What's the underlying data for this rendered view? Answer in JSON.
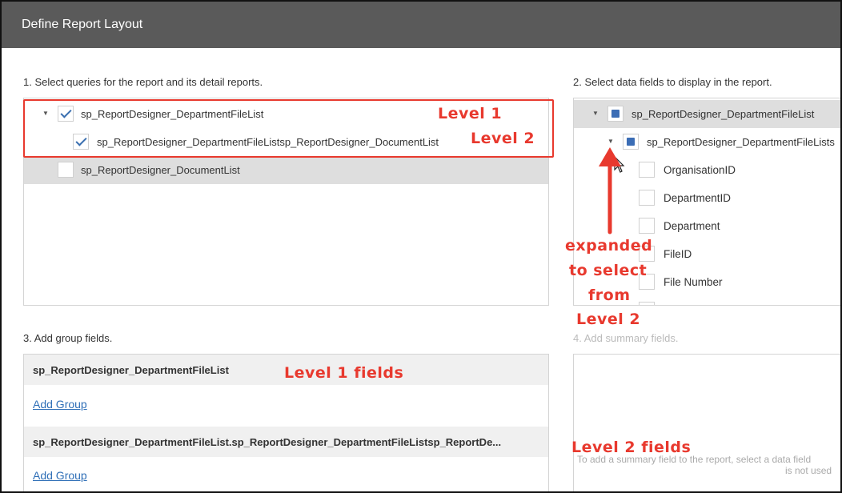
{
  "window": {
    "title": "Define Report Layout"
  },
  "sections": {
    "queries_label": "1. Select queries for the report and its detail reports.",
    "fields_label": "2. Select data fields to display in the report.",
    "group_label": "3. Add group fields.",
    "summary_label": "4. Add summary fields."
  },
  "queries": [
    {
      "label": "sp_ReportDesigner_DepartmentFileList",
      "checked": true,
      "expanded": true
    },
    {
      "label": "sp_ReportDesigner_DepartmentFileListsp_ReportDesigner_DocumentList",
      "checked": true
    },
    {
      "label": "sp_ReportDesigner_DocumentList",
      "checked": false,
      "selected": true
    }
  ],
  "fields_tree": {
    "root": "sp_ReportDesigner_DepartmentFileList",
    "child": "sp_ReportDesigner_DepartmentFileLists",
    "fields": [
      "OrganisationID",
      "DepartmentID",
      "Department",
      "FileID",
      "File Number"
    ]
  },
  "groups": [
    {
      "header": "sp_ReportDesigner_DepartmentFileList",
      "link": "Add Group"
    },
    {
      "header": "sp_ReportDesigner_DepartmentFileList.sp_ReportDesigner_DepartmentFileListsp_ReportDe...",
      "link": "Add Group"
    }
  ],
  "summary_hint": {
    "line1": "To add a summary field to the report, select a data field",
    "line2": "is not used"
  },
  "annotations": {
    "level1": "Level 1",
    "level2": "Level 2",
    "expanded_1": "expanded",
    "expanded_2": "to select",
    "expanded_3": "from",
    "expanded_4": "Level 2",
    "level1_fields": "Level 1 fields",
    "level2_fields": "Level 2 fields"
  },
  "colors": {
    "annotation": "#e8392e",
    "titlebar": "#5a5a5a",
    "check": "#3a6fb0",
    "link": "#2f6fb7"
  }
}
